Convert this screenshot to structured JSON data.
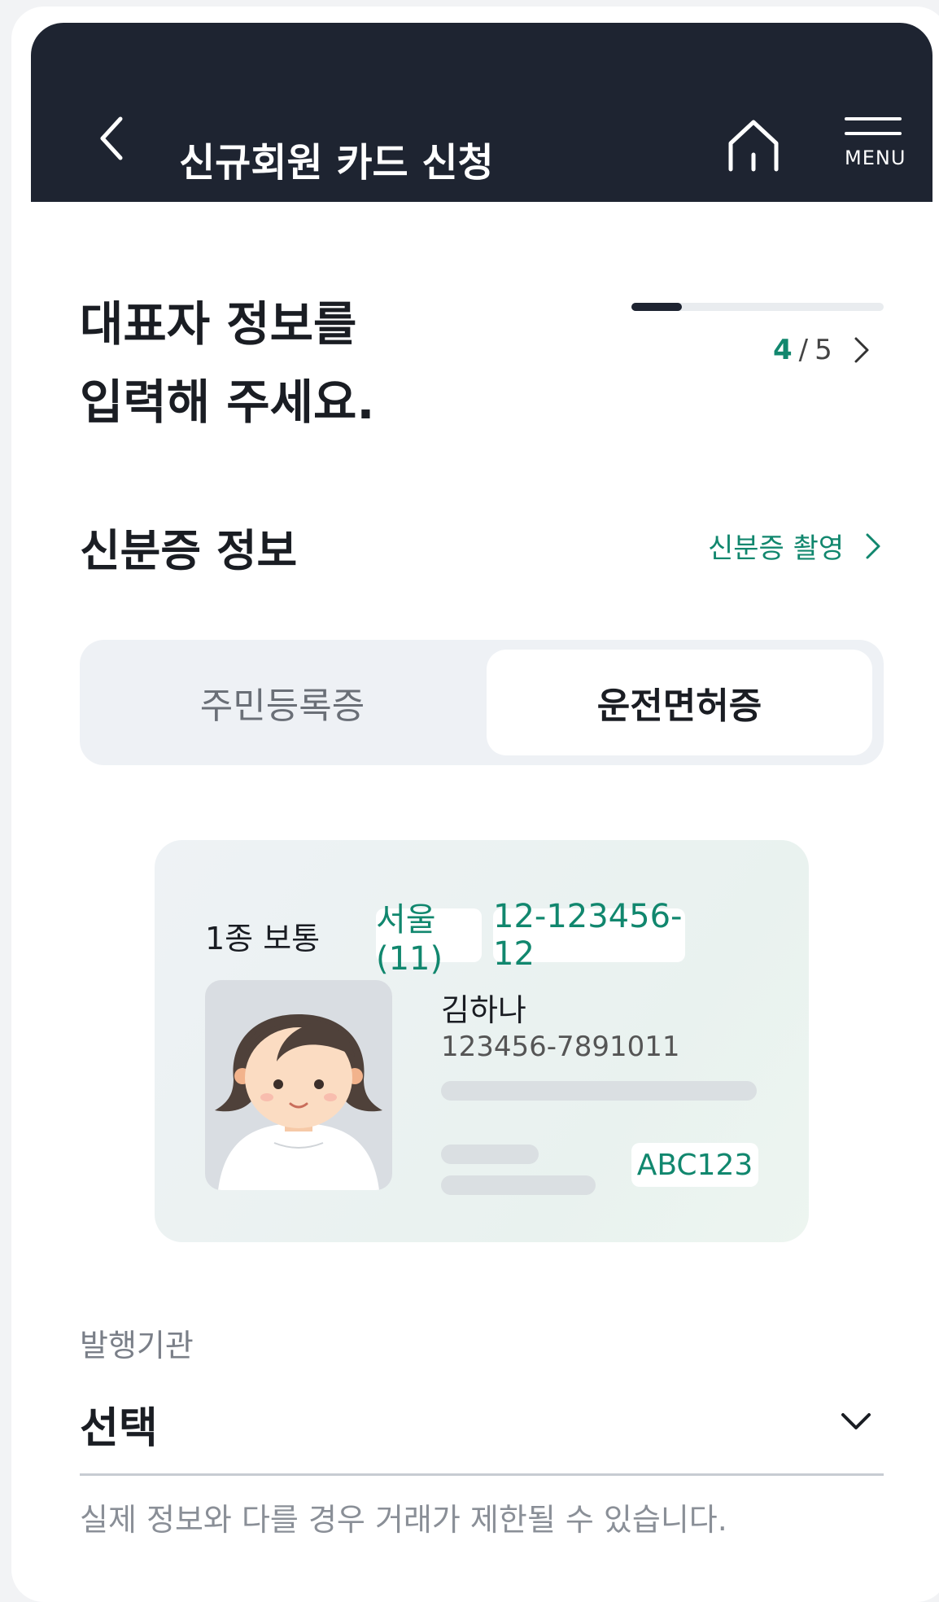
{
  "header": {
    "title": "신규회원 카드 신청",
    "menu_label": "MENU"
  },
  "page": {
    "title_line1": "대표자 정보를",
    "title_line2": "입력해 주세요.",
    "progress": {
      "current": "4",
      "total": "5",
      "fraction": 0.2
    }
  },
  "id_section": {
    "title": "신분증 정보",
    "capture_link": "신분증 촬영",
    "tabs": [
      {
        "label": "주민등록증",
        "selected": false
      },
      {
        "label": "운전면허증",
        "selected": true
      }
    ]
  },
  "license_card": {
    "license_type": "1종 보통",
    "region": "서울(11)",
    "license_number": "12-123456-12",
    "name": "김하나",
    "resident_number": "123456-7891011",
    "serial": "ABC123"
  },
  "issuer": {
    "label": "발행기관",
    "value": "선택",
    "helper": "실제 정보와 다를 경우 거래가 제한될 수 있습니다."
  },
  "colors": {
    "accent": "#11876e",
    "header_bg": "#1e2431"
  }
}
